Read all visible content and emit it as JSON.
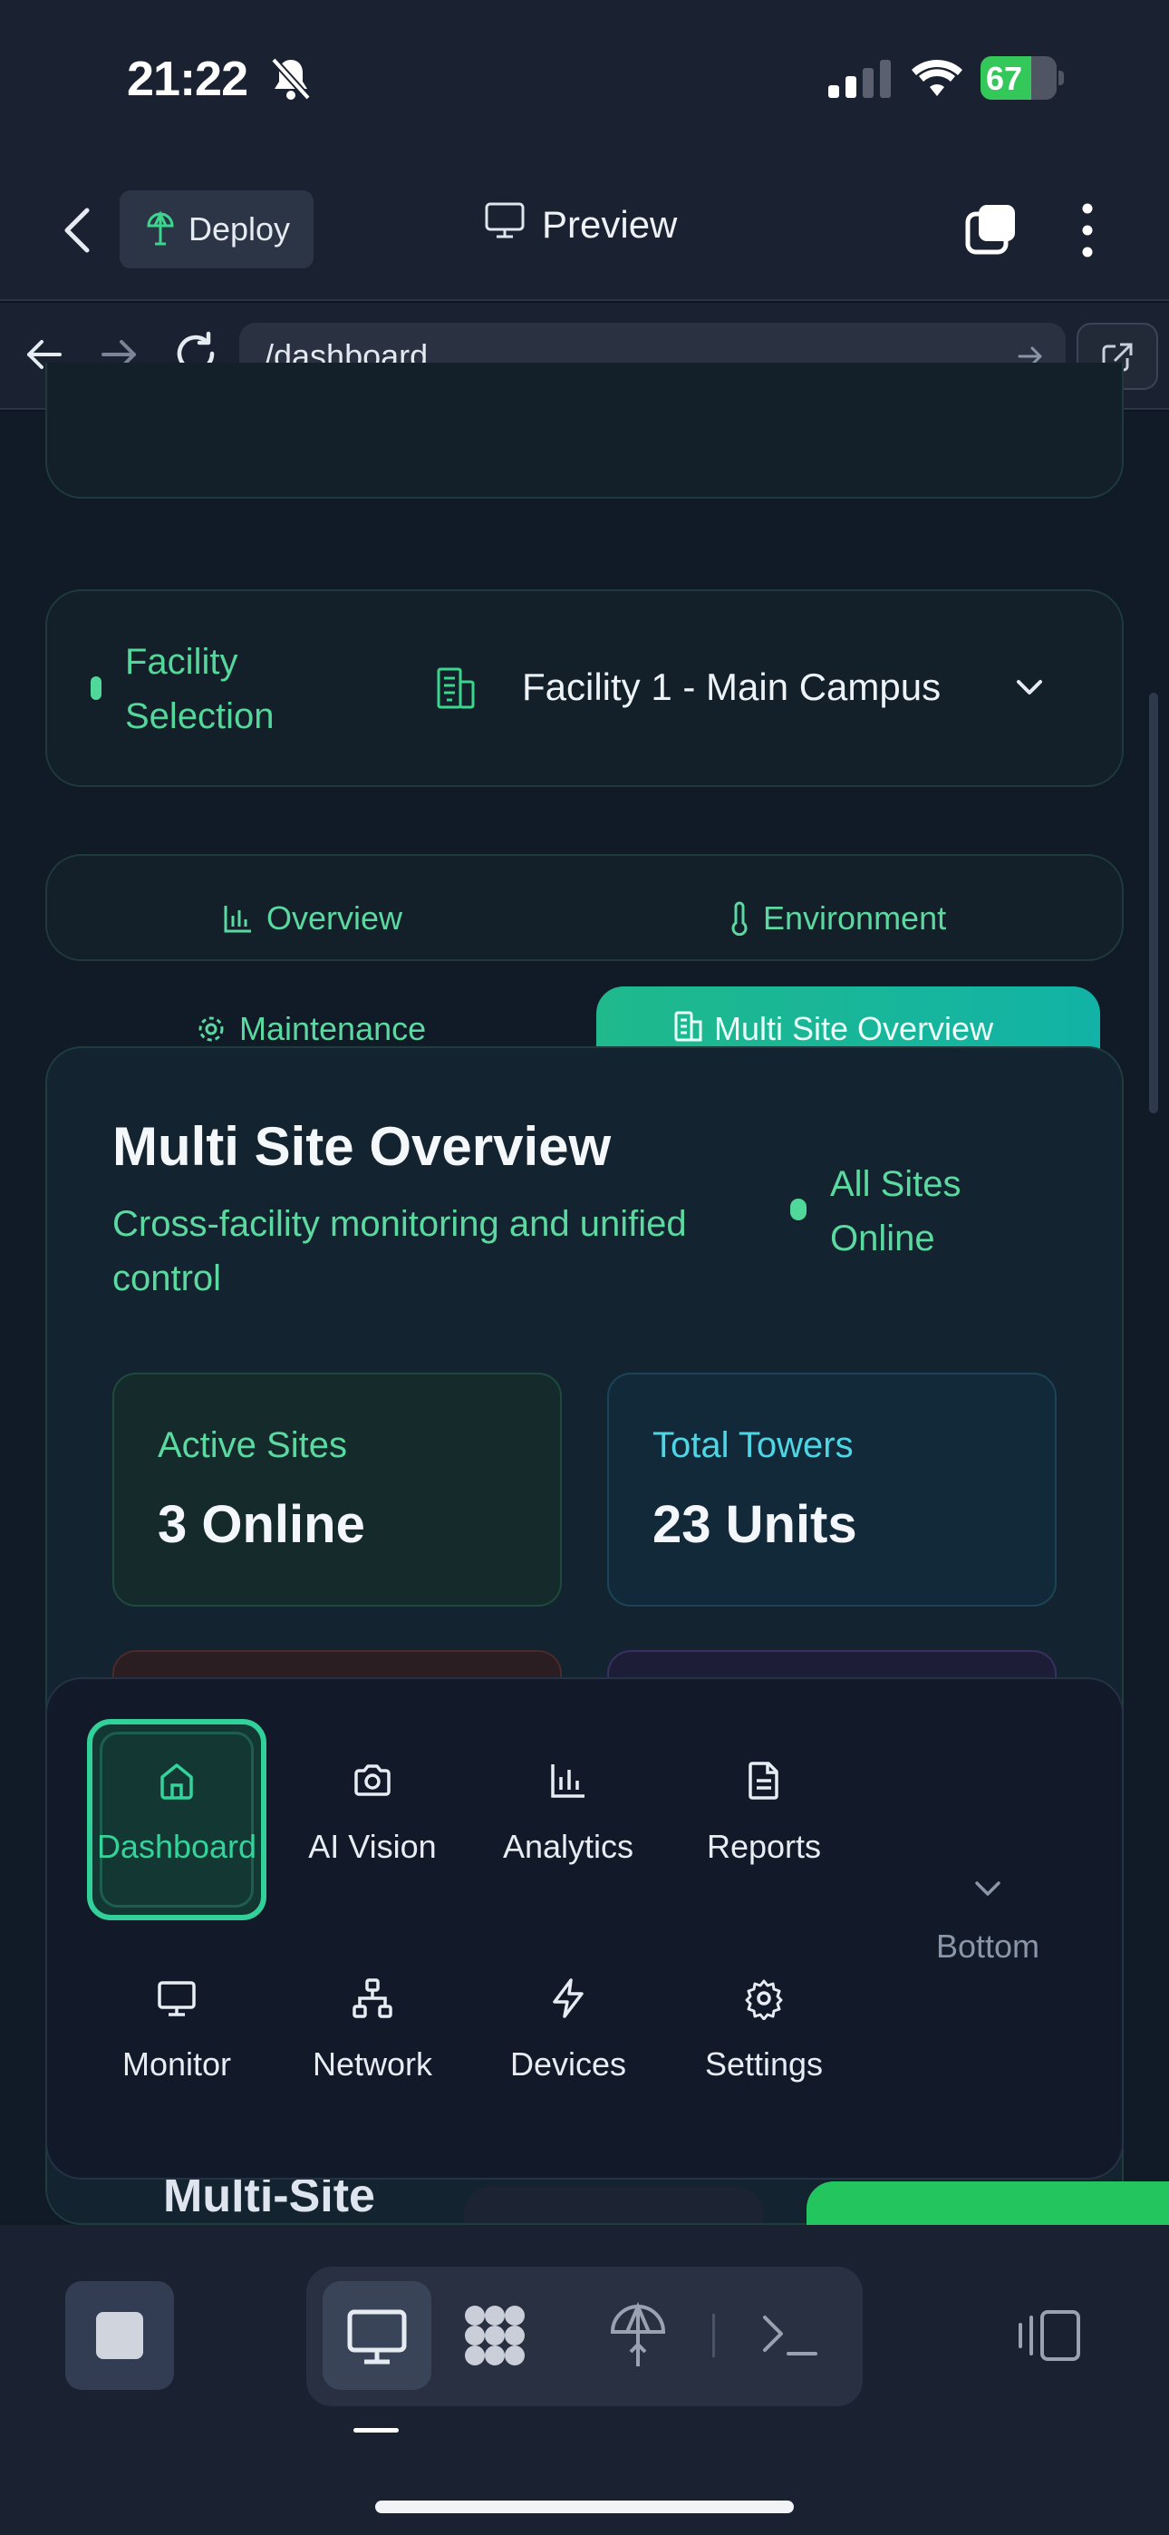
{
  "status_bar": {
    "time": "21:22",
    "battery": "67",
    "battery_level": 0.67,
    "icons": [
      "bell-slash-icon",
      "cellular-signal-icon",
      "wifi-icon",
      "battery-icon"
    ]
  },
  "header": {
    "deploy_label": "Deploy",
    "title": "Preview"
  },
  "url_bar": {
    "path": "/dashboard"
  },
  "facility": {
    "label": "Facility Selection",
    "selected": "Facility 1 - Main Campus"
  },
  "tabs": {
    "overview": "Overview",
    "environment": "Environment",
    "maintenance": "Maintenance",
    "multi_site": "Multi Site Overview"
  },
  "multi_site": {
    "title": "Multi Site Overview",
    "subtitle": "Cross-facility monitoring and unified control",
    "status": "All Sites Online",
    "stats": [
      {
        "label": "Active Sites",
        "value": "3 Online"
      },
      {
        "label": "Total Towers",
        "value": "23 Units"
      }
    ],
    "heading_2": "Multi-Site"
  },
  "bottom_nav": {
    "items": [
      {
        "label": "Dashboard",
        "icon": "home-icon"
      },
      {
        "label": "AI Vision",
        "icon": "camera-icon"
      },
      {
        "label": "Analytics",
        "icon": "bar-chart-icon"
      },
      {
        "label": "Reports",
        "icon": "document-icon"
      },
      {
        "label": "Monitor",
        "icon": "monitor-icon"
      },
      {
        "label": "Network",
        "icon": "network-icon"
      },
      {
        "label": "Devices",
        "icon": "lightning-icon"
      },
      {
        "label": "Settings",
        "icon": "gear-icon"
      }
    ],
    "position_toggle": "Bottom"
  },
  "colors": {
    "accent": "#34d39a",
    "accent_teal": "#12b3a6",
    "background": "#111a27",
    "panel": "#121a2a",
    "add_button": "#22c55e"
  }
}
